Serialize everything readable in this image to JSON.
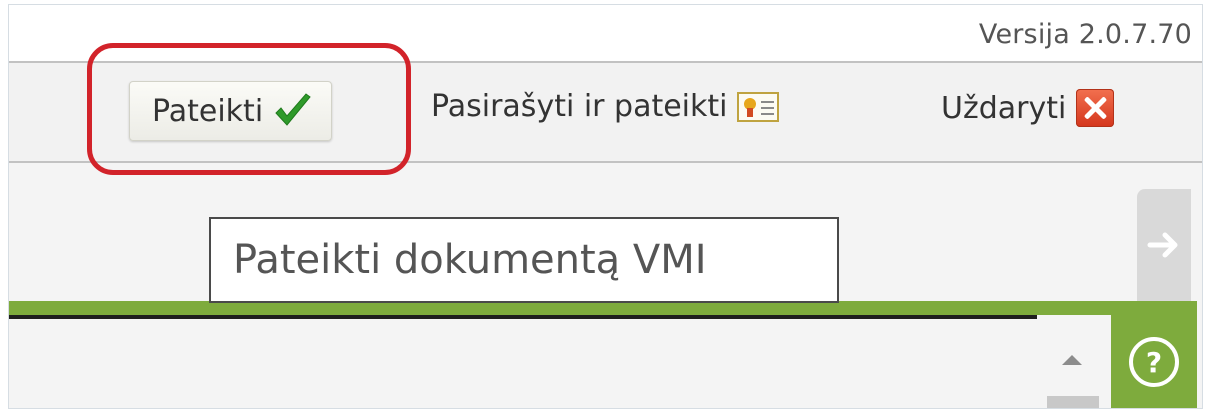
{
  "header": {
    "version": "Versija 2.0.7.70"
  },
  "toolbar": {
    "submit_label": "Pateikti",
    "sign_submit_label": "Pasirašyti ir pateikti",
    "close_label": "Uždaryti"
  },
  "tooltip": {
    "text": "Pateikti dokumentą VMI"
  },
  "help": {
    "glyph": "?"
  },
  "icons": {
    "submit": "check-icon",
    "sign_submit": "certificate-icon",
    "close": "close-icon",
    "side": "arrow-right-icon",
    "help": "help-icon"
  },
  "colors": {
    "highlight": "#d2232a",
    "check": "#2f9a2a",
    "accent_green": "#7eab3d",
    "close": "#e2512f"
  }
}
